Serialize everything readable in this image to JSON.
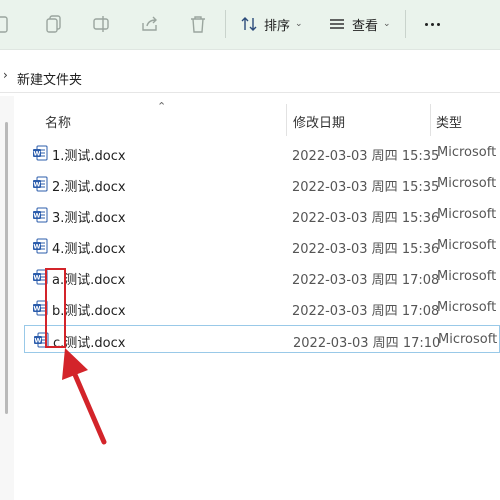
{
  "toolbar": {
    "icons": [
      "new-item-icon",
      "copy-icon",
      "rename-icon",
      "share-icon",
      "delete-icon"
    ],
    "sort_label": "排序",
    "view_label": "查看",
    "more_icon": "more-dots-icon"
  },
  "address": {
    "path": "新建文件夹"
  },
  "columns": {
    "name": "名称",
    "date": "修改日期",
    "type": "类型"
  },
  "files": [
    {
      "name": "1.测试.docx",
      "date": "2022-03-03 周四 15:35",
      "type": "Microsoft W"
    },
    {
      "name": "2.测试.docx",
      "date": "2022-03-03 周四 15:35",
      "type": "Microsoft W"
    },
    {
      "name": "3.测试.docx",
      "date": "2022-03-03 周四 15:36",
      "type": "Microsoft W"
    },
    {
      "name": "4.测试.docx",
      "date": "2022-03-03 周四 15:36",
      "type": "Microsoft W"
    },
    {
      "name": "a.测试.docx",
      "date": "2022-03-03 周四 17:08",
      "type": "Microsoft W"
    },
    {
      "name": "b.测试.docx",
      "date": "2022-03-03 周四 17:08",
      "type": "Microsoft W"
    },
    {
      "name": "c.测试.docx",
      "date": "2022-03-03 周四 17:10",
      "type": "Microsoft W"
    }
  ],
  "colors": {
    "toolbar_bg": "#eaf3ec",
    "word_blue": "#2b5cab",
    "annotation_red": "#d3242a",
    "selection_border": "#99c9e8"
  }
}
